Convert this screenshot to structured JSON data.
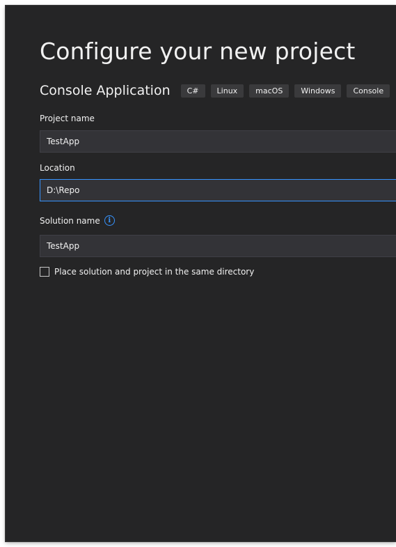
{
  "dialog": {
    "title": "Configure your new project",
    "template": {
      "name": "Console Application",
      "tags": [
        "C#",
        "Linux",
        "macOS",
        "Windows",
        "Console"
      ]
    },
    "project_name": {
      "label": "Project name",
      "value": "TestApp"
    },
    "location": {
      "label": "Location",
      "value": "D:\\Repo"
    },
    "solution_name": {
      "label": "Solution name",
      "info_icon": "info-icon",
      "value": "TestApp"
    },
    "same_directory": {
      "label": "Place solution and project in the same directory",
      "checked": false
    }
  },
  "colors": {
    "background": "#252526",
    "text": "#f1f1f1",
    "input_bg": "#333337",
    "input_border": "#3f3f46",
    "focus_border": "#3794ff",
    "tag_bg": "#3a3a3c"
  }
}
